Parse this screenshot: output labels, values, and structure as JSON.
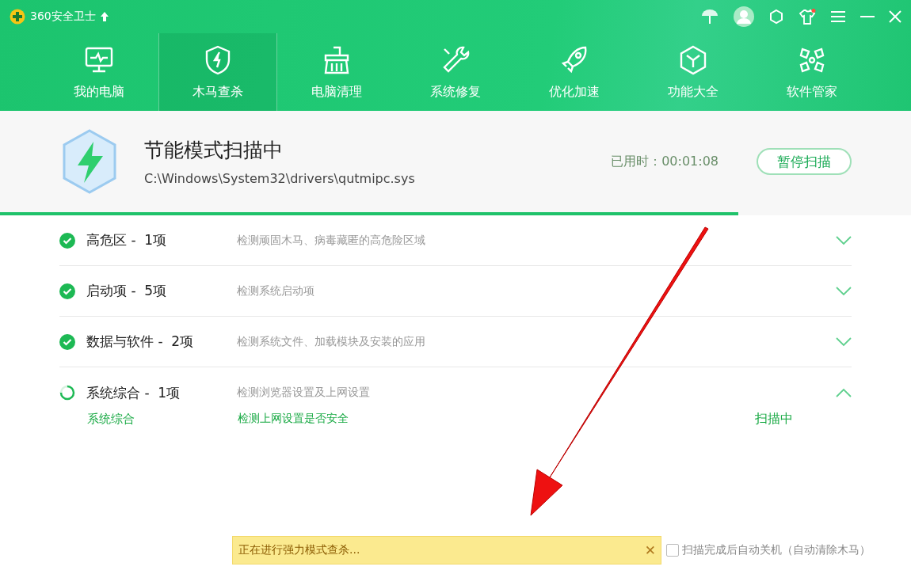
{
  "app": {
    "title": "360安全卫士"
  },
  "nav": [
    {
      "label": "我的电脑",
      "selected": false
    },
    {
      "label": "木马查杀",
      "selected": true
    },
    {
      "label": "电脑清理",
      "selected": false
    },
    {
      "label": "系统修复",
      "selected": false
    },
    {
      "label": "优化加速",
      "selected": false
    },
    {
      "label": "功能大全",
      "selected": false
    },
    {
      "label": "软件管家",
      "selected": false
    }
  ],
  "scan": {
    "title": "节能模式扫描中",
    "path": "C:\\Windows\\System32\\drivers\\qutmipc.sys",
    "elapsed": "已用时：00:01:08",
    "pause_button": "暂停扫描",
    "level": 0.81
  },
  "groups": [
    {
      "name": "高危区 -  1项",
      "description": "检测顽固木马、病毒藏匿的高危险区域",
      "kind": "done",
      "expanded": false
    },
    {
      "name": "启动项 -  5项",
      "description": "检测系统启动项",
      "kind": "done",
      "expanded": false
    },
    {
      "name": "数据与软件 -  2项",
      "description": "检测系统文件、加载模块及安装的应用",
      "kind": "done",
      "expanded": false
    },
    {
      "name": "系统综合 -  1项",
      "description": "检测浏览器设置及上网设置",
      "kind": "scanning",
      "expanded": true,
      "children": [
        {
          "name": "系统综合",
          "description": "检测上网设置是否安全",
          "state": "扫描中"
        }
      ]
    }
  ],
  "notice": {
    "text": "正在进行强力模式查杀...",
    "close": "✕"
  },
  "auto_shutdown": {
    "label": "扫描完成后自动关机（自动清除木马）",
    "checked": false
  }
}
